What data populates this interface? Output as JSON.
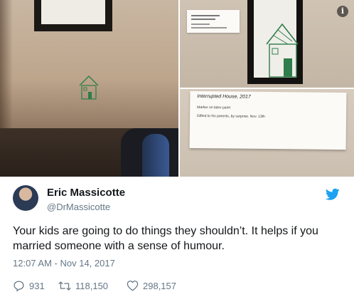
{
  "media": {
    "info_icon": "info-icon",
    "label_card": {
      "title": "Interrupted House, 2017",
      "medium": "Marker on latex paint",
      "note": "Gifted to his parents, by surprise. Nov. 13th"
    }
  },
  "author": {
    "name": "Eric Massicotte",
    "handle": "@DrMassicotte",
    "avatar_icon": "avatar",
    "platform_icon": "twitter-bird-icon",
    "platform_color": "#1da1f2"
  },
  "tweet": {
    "text": "Your kids are going to do things they shouldn’t. It helps if you married someone with a sense of humour.",
    "timestamp": "12:07 AM - Nov 14, 2017"
  },
  "actions": {
    "replies": "931",
    "retweets": "118,150",
    "likes": "298,157",
    "reply_icon": "reply-icon",
    "retweet_icon": "retweet-icon",
    "like_icon": "heart-icon"
  }
}
